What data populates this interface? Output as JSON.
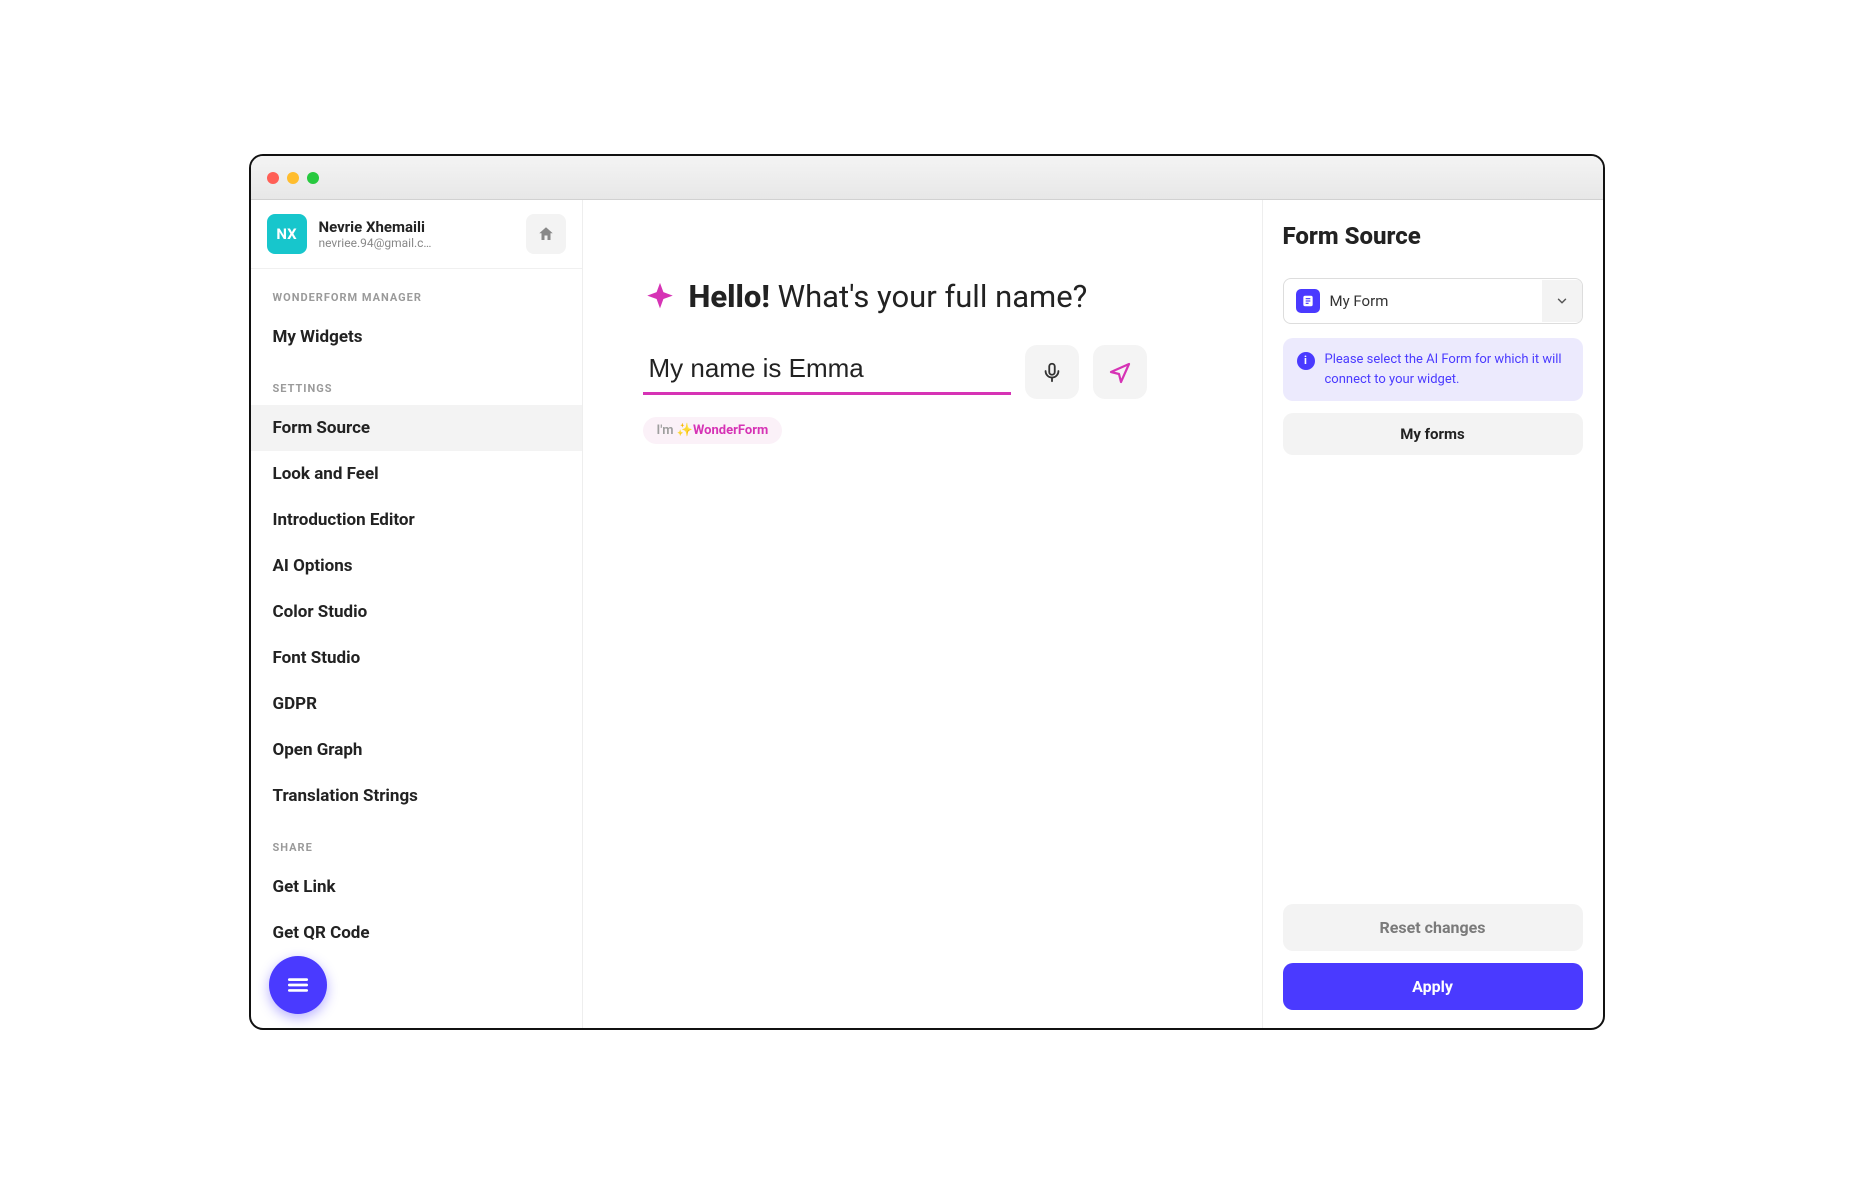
{
  "user": {
    "initials": "NX",
    "name": "Nevrie Xhemaili",
    "email": "nevriee.94@gmail.c…"
  },
  "sidebar": {
    "section_manager": "WONDERFORM MANAGER",
    "my_widgets": "My Widgets",
    "section_settings": "SETTINGS",
    "settings_items": [
      "Form Source",
      "Look and Feel",
      "Introduction Editor",
      "AI Options",
      "Color Studio",
      "Font Studio",
      "GDPR",
      "Open Graph",
      "Translation Strings"
    ],
    "section_share": "SHARE",
    "share_items": [
      "Get Link",
      "Get QR Code"
    ]
  },
  "preview": {
    "hello": "Hello!",
    "question": "What's your full name?",
    "input_value": "My name is Emma",
    "chip_prefix": "I'm ",
    "chip_sparkle": "✨",
    "chip_brand": "WonderForm"
  },
  "panel": {
    "title": "Form Source",
    "select_label": "My Form",
    "info_text": "Please select the AI Form for which it will connect to your widget.",
    "my_forms": "My forms",
    "reset": "Reset changes",
    "apply": "Apply"
  }
}
